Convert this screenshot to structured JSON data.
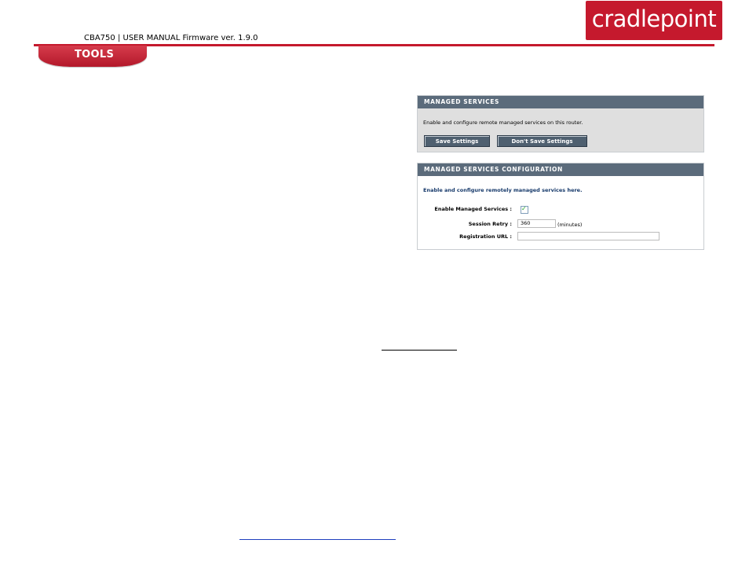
{
  "header": {
    "doc_title": "CBA750 | USER MANUAL Firmware ver. 1.9.0",
    "logo_text": "cradlepoint",
    "section_tab": "TOOLS"
  },
  "managed_services": {
    "title": "MANAGED SERVICES",
    "description": "Enable and configure remote managed services on this router.",
    "save_label": "Save Settings",
    "dont_save_label": "Don't Save Settings"
  },
  "config": {
    "title": "MANAGED SERVICES CONFIGURATION",
    "intro": "Enable and configure remotely managed services here.",
    "enable_label": "Enable Managed Services :",
    "enable_checked": true,
    "enable_check_glyph": "✓",
    "session_retry_label": "Session Retry :",
    "session_retry_value": "360",
    "session_retry_unit": "(minutes)",
    "registration_url_label": "Registration URL :",
    "registration_url_value": ""
  },
  "colors": {
    "brand_red": "#c5192d",
    "panel_title_bg": "#5b6b7b",
    "button_bg": "#4f6070",
    "intro_text": "#173a6b",
    "link_underline": "#1f3fbf"
  }
}
